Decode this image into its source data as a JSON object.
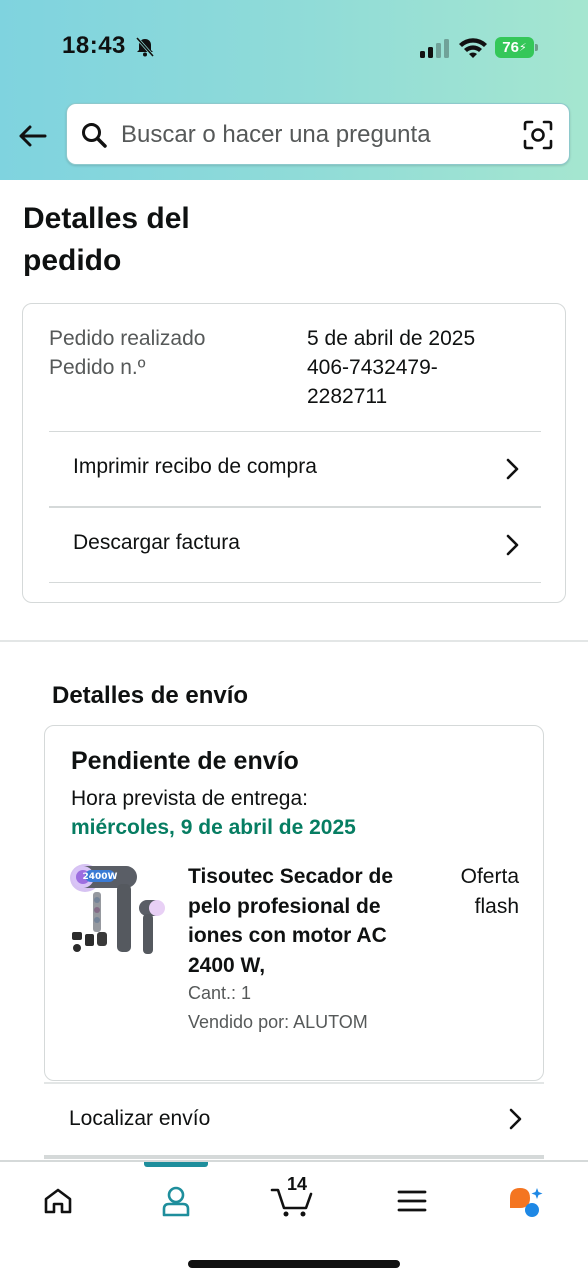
{
  "status_bar": {
    "time": "18:43",
    "battery": "76",
    "icons": [
      "bell-muted-icon",
      "signal-icon",
      "wifi-icon",
      "battery-icon"
    ]
  },
  "header": {
    "search_placeholder": "Buscar o hacer una pregunta",
    "icons": [
      "back-arrow-icon",
      "search-icon",
      "camera-icon"
    ]
  },
  "page": {
    "title": "Detalles del pedido"
  },
  "order": {
    "placed_label": "Pedido realizado",
    "placed_value": "5 de abril de 2025",
    "number_label": "Pedido n.º",
    "number_value_line1": "406-7432479-",
    "number_value_line2": "2282711",
    "links": [
      {
        "label": "Imprimir recibo de compra"
      },
      {
        "label": "Descargar factura"
      }
    ]
  },
  "shipping": {
    "section_title": "Detalles de envío",
    "status": "Pendiente de envío",
    "eta_label": "Hora prevista de entrega:",
    "eta_date": "miércoles, 9 de abril de 2025",
    "product": {
      "name": "Tisoutec Secador de pelo profesional de iones con motor AC 2400 W,",
      "badge_line1": "Oferta",
      "badge_line2": "flash",
      "quantity": "Cant.: 1",
      "seller": "Vendido por: ALUTOM",
      "image_text": "2400W"
    },
    "track_label": "Localizar envío"
  },
  "tabbar": {
    "cart_count": "14",
    "tabs": [
      "home-icon",
      "account-icon",
      "cart-icon",
      "menu-icon",
      "rufus-icon"
    ],
    "active_tab": "account-icon"
  },
  "colors": {
    "header_gradient_start": "#7fd3df",
    "header_gradient_end": "#a5e6d0",
    "delivery_green": "#067d62",
    "active_tab": "#1e8e9c",
    "battery_green": "#34c759"
  }
}
